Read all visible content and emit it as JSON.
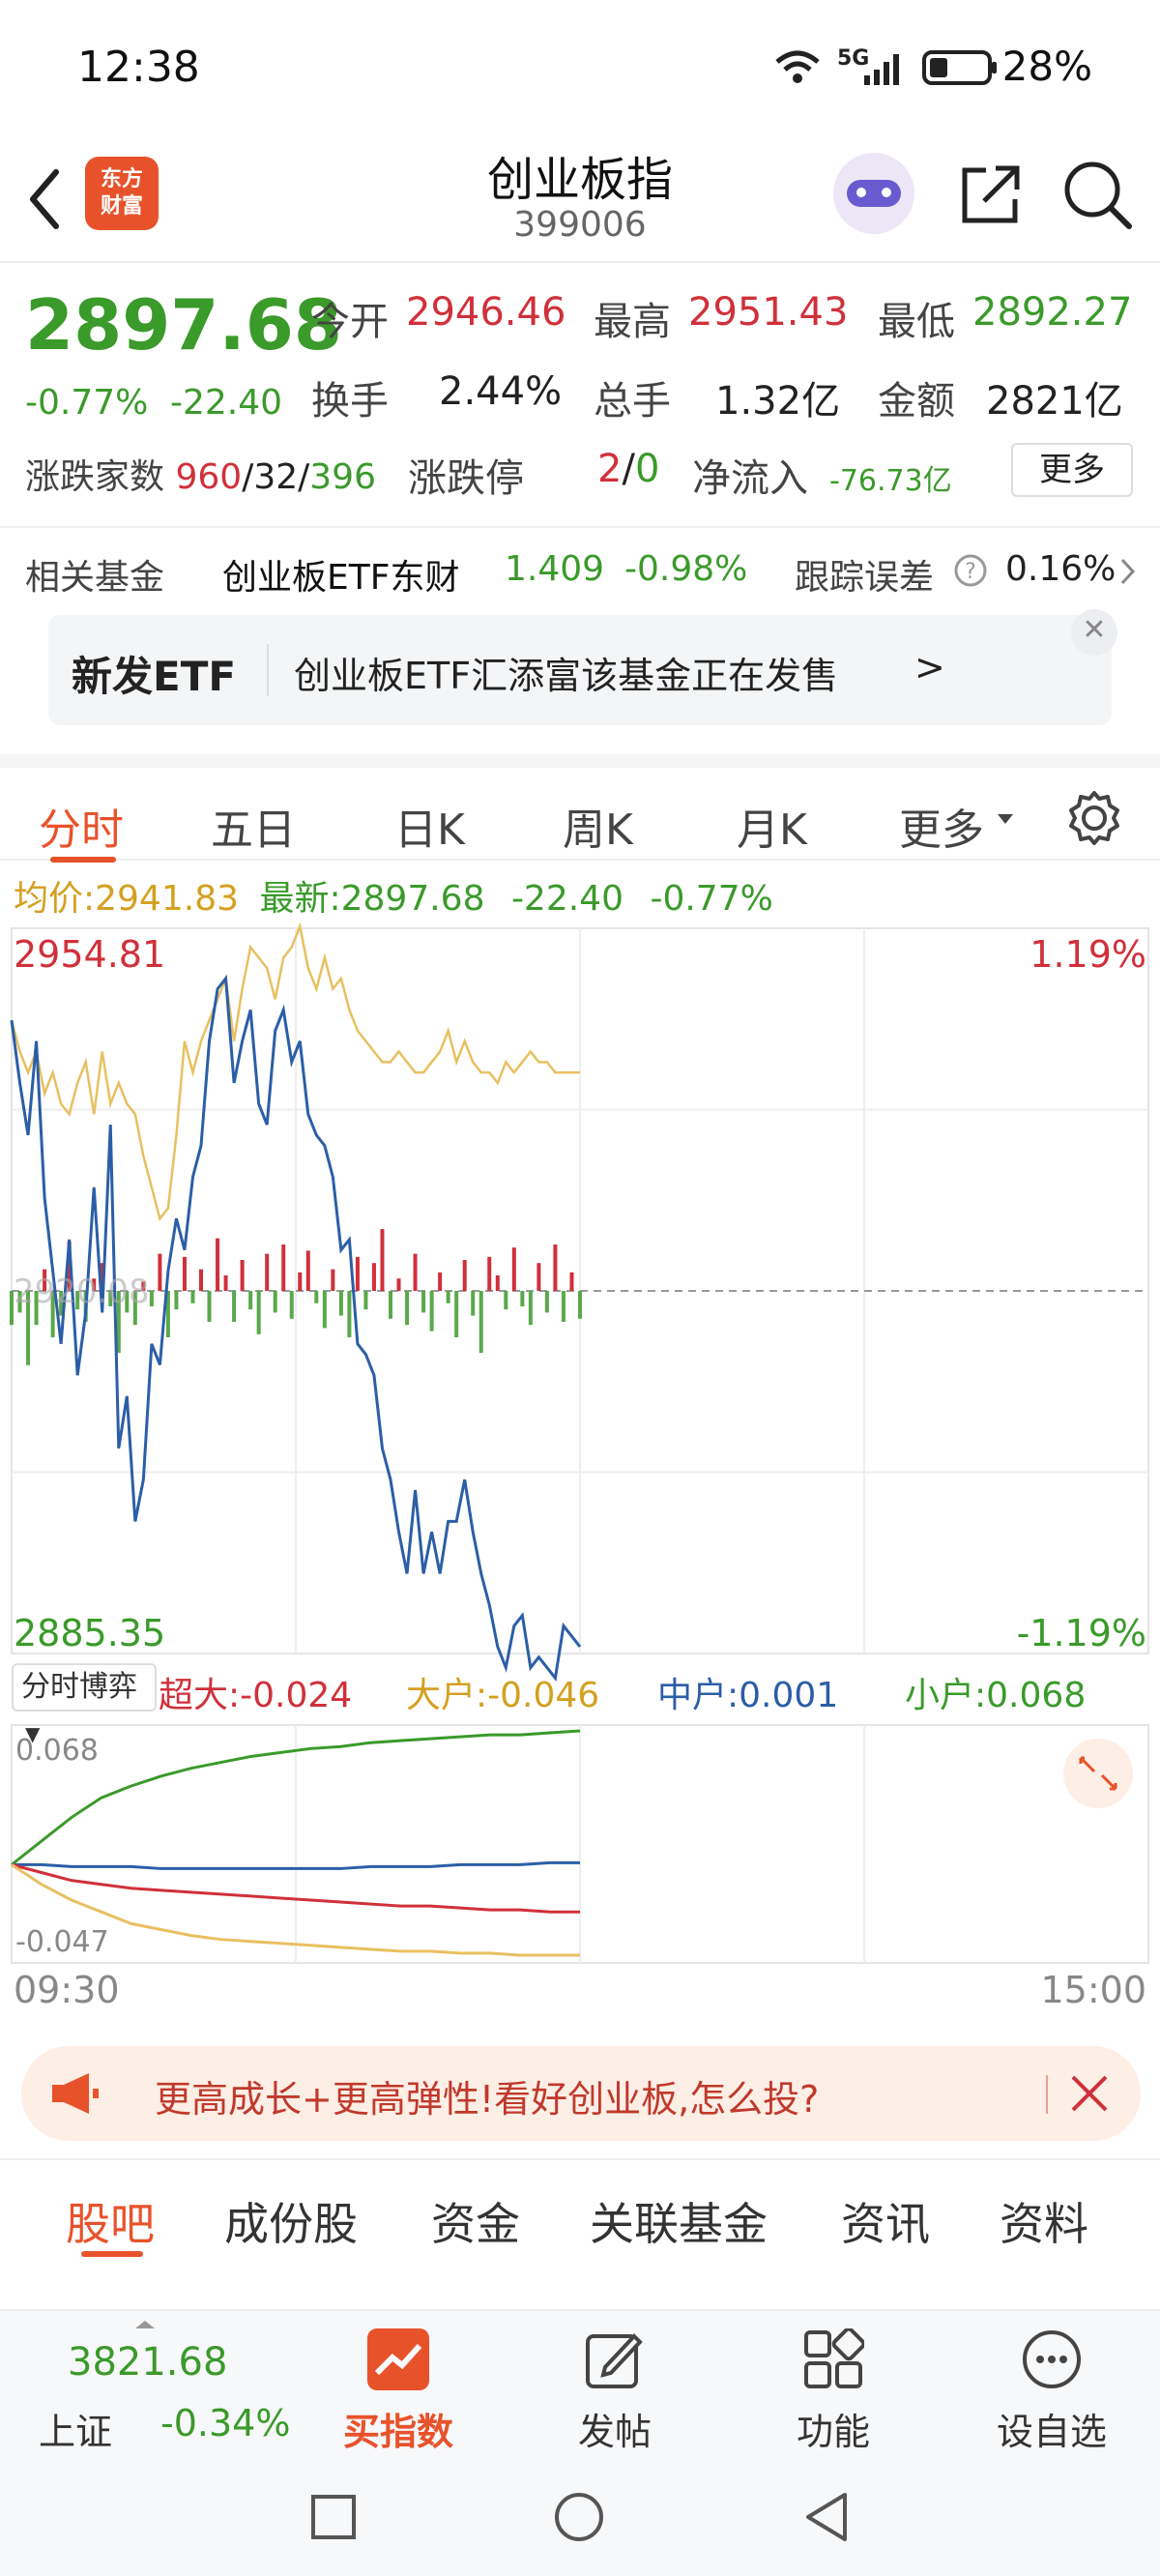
{
  "status": {
    "time": "12:38",
    "network": "5G",
    "battery": "28%"
  },
  "header": {
    "app_logo": "东方财富",
    "title": "创业板指",
    "code": "399006"
  },
  "quote": {
    "price": "2897.68",
    "change_pct": "-0.77%",
    "change": "-22.40",
    "open_label": "今开",
    "open": "2946.46",
    "high_label": "最高",
    "high": "2951.43",
    "low_label": "最低",
    "low": "2892.27",
    "turnover_label": "换手",
    "turnover": "2.44%",
    "volume_label": "总手",
    "volume": "1.32亿",
    "amount_label": "金额",
    "amount": "2821亿",
    "breadth_label": "涨跌家数",
    "breadth_up": "960",
    "breadth_flat": "32",
    "breadth_down": "396",
    "limit_label": "涨跌停",
    "limit_up": "2",
    "limit_down": "0",
    "inflow_label": "净流入",
    "inflow": "-76.73亿",
    "more_button": "更多"
  },
  "fund": {
    "label": "相关基金",
    "name": "创业板ETF东财",
    "price": "1.409",
    "change": "-0.98%",
    "tracking_label": "跟踪误差",
    "tracking_value": "0.16%"
  },
  "promo": {
    "tag": "新发ETF",
    "text": "创业板ETF汇添富该基金正在发售",
    "arrow": ">"
  },
  "chart_tabs": [
    "分时",
    "五日",
    "日K",
    "周K",
    "月K",
    "更多"
  ],
  "avg_row": {
    "avg_label": "均价:",
    "avg": "2941.83",
    "latest_label": "最新:",
    "latest": "2897.68",
    "change": "-22.40",
    "change_pct": "-0.77%"
  },
  "chart_data": {
    "type": "line",
    "y_max": "2954.81",
    "y_min": "2885.35",
    "y_mid": "2920.08",
    "pct_max": "1.19%",
    "pct_min": "-1.19%",
    "x_start": "09:30",
    "x_end": "15:00",
    "price_color": "#2b5ea7",
    "avg_color": "#e8c060",
    "price": [
      2946,
      2940,
      2935,
      2944,
      2929,
      2922,
      2915,
      2925,
      2912,
      2918,
      2930,
      2918,
      2936,
      2905,
      2910,
      2898,
      2902,
      2915,
      2913,
      2922,
      2927,
      2924,
      2931,
      2934,
      2944,
      2949,
      2950,
      2940,
      2944,
      2947,
      2938,
      2936,
      2945,
      2947,
      2942,
      2944,
      2937,
      2935,
      2934,
      2931,
      2924,
      2925,
      2915,
      2914,
      2912,
      2905,
      2902,
      2897,
      2893,
      2901,
      2893,
      2897,
      2893,
      2898,
      2898,
      2902,
      2897,
      2893,
      2890,
      2886,
      2884,
      2888,
      2889,
      2884,
      2885,
      2884,
      2883,
      2888,
      2887,
      2886
    ],
    "avg": [
      2946,
      2943,
      2941,
      2943,
      2939,
      2941,
      2938,
      2937,
      2940,
      2942,
      2937,
      2943,
      2938,
      2940,
      2938,
      2937,
      2933,
      2930,
      2927,
      2928,
      2935,
      2944,
      2941,
      2944,
      2946,
      2948,
      2950,
      2944,
      2949,
      2953,
      2952,
      2951,
      2948,
      2952,
      2953,
      2955,
      2951,
      2949,
      2952,
      2949,
      2950,
      2947,
      2945,
      2944,
      2943,
      2942,
      2942,
      2943,
      2942,
      2941,
      2941,
      2942,
      2943,
      2945,
      2942,
      2944,
      2942,
      2941,
      2941,
      2940,
      2942,
      2941,
      2942,
      2943,
      2942,
      2942,
      2941,
      2941,
      2941,
      2941
    ],
    "volume": [
      -22,
      -14,
      -48,
      -22,
      14,
      -30,
      -16,
      32,
      -12,
      -20,
      8,
      18,
      -10,
      -40,
      -14,
      -22,
      6,
      -10,
      24,
      -30,
      -12,
      22,
      -8,
      14,
      -20,
      34,
      10,
      -20,
      20,
      -12,
      -28,
      24,
      -14,
      30,
      -18,
      12,
      26,
      -8,
      -24,
      14,
      -16,
      -30,
      22,
      -12,
      18,
      40,
      -18,
      8,
      -22,
      24,
      -14,
      -26,
      12,
      -8,
      -30,
      20,
      -16,
      -40,
      22,
      10,
      -12,
      28,
      -10,
      -22,
      18,
      -14,
      30,
      -20,
      12,
      -18
    ],
    "ytick_labels": [
      "2954.81",
      "2920.08",
      "2885.35"
    ]
  },
  "capital_flow": {
    "selector": "分时博弈",
    "super_label": "超大",
    "super": "-0.024",
    "large_label": "大户",
    "large": "-0.046",
    "mid_label": "中户",
    "mid": "0.001",
    "small_label": "小户",
    "small": "0.068",
    "max": "0.068",
    "min": "-0.047",
    "series": [
      {
        "name": "小户",
        "color": "#3a9a2a",
        "values": [
          0,
          0.012,
          0.024,
          0.034,
          0.04,
          0.045,
          0.049,
          0.052,
          0.055,
          0.057,
          0.059,
          0.06,
          0.062,
          0.063,
          0.064,
          0.065,
          0.066,
          0.066,
          0.067,
          0.068
        ]
      },
      {
        "name": "中户",
        "color": "#2b5ea7",
        "values": [
          0,
          0.0,
          -0.001,
          -0.001,
          -0.001,
          -0.002,
          -0.002,
          -0.002,
          -0.002,
          -0.002,
          -0.002,
          -0.002,
          -0.001,
          -0.001,
          -0.001,
          0.0,
          0.0,
          0.0,
          0.001,
          0.001
        ]
      },
      {
        "name": "超大",
        "color": "#d0303a",
        "values": [
          0,
          -0.004,
          -0.008,
          -0.01,
          -0.012,
          -0.013,
          -0.014,
          -0.015,
          -0.016,
          -0.017,
          -0.018,
          -0.019,
          -0.02,
          -0.021,
          -0.021,
          -0.022,
          -0.023,
          -0.023,
          -0.024,
          -0.024
        ]
      },
      {
        "name": "大户",
        "color": "#e8c060",
        "values": [
          0,
          -0.01,
          -0.018,
          -0.024,
          -0.03,
          -0.033,
          -0.036,
          -0.038,
          -0.039,
          -0.04,
          -0.041,
          -0.042,
          -0.043,
          -0.044,
          -0.044,
          -0.045,
          -0.045,
          -0.046,
          -0.046,
          -0.046
        ]
      }
    ]
  },
  "banner": {
    "text": "更高成长+更高弹性!看好创业板,怎么投?"
  },
  "bottom_tabs": [
    "股吧",
    "成份股",
    "资金",
    "关联基金",
    "资讯",
    "资料"
  ],
  "toolbar": {
    "index_value": "3821.68",
    "index_name": "上证",
    "index_change": "-0.34%",
    "buy": "买指数",
    "post": "发帖",
    "func": "功能",
    "watch": "设自选"
  }
}
